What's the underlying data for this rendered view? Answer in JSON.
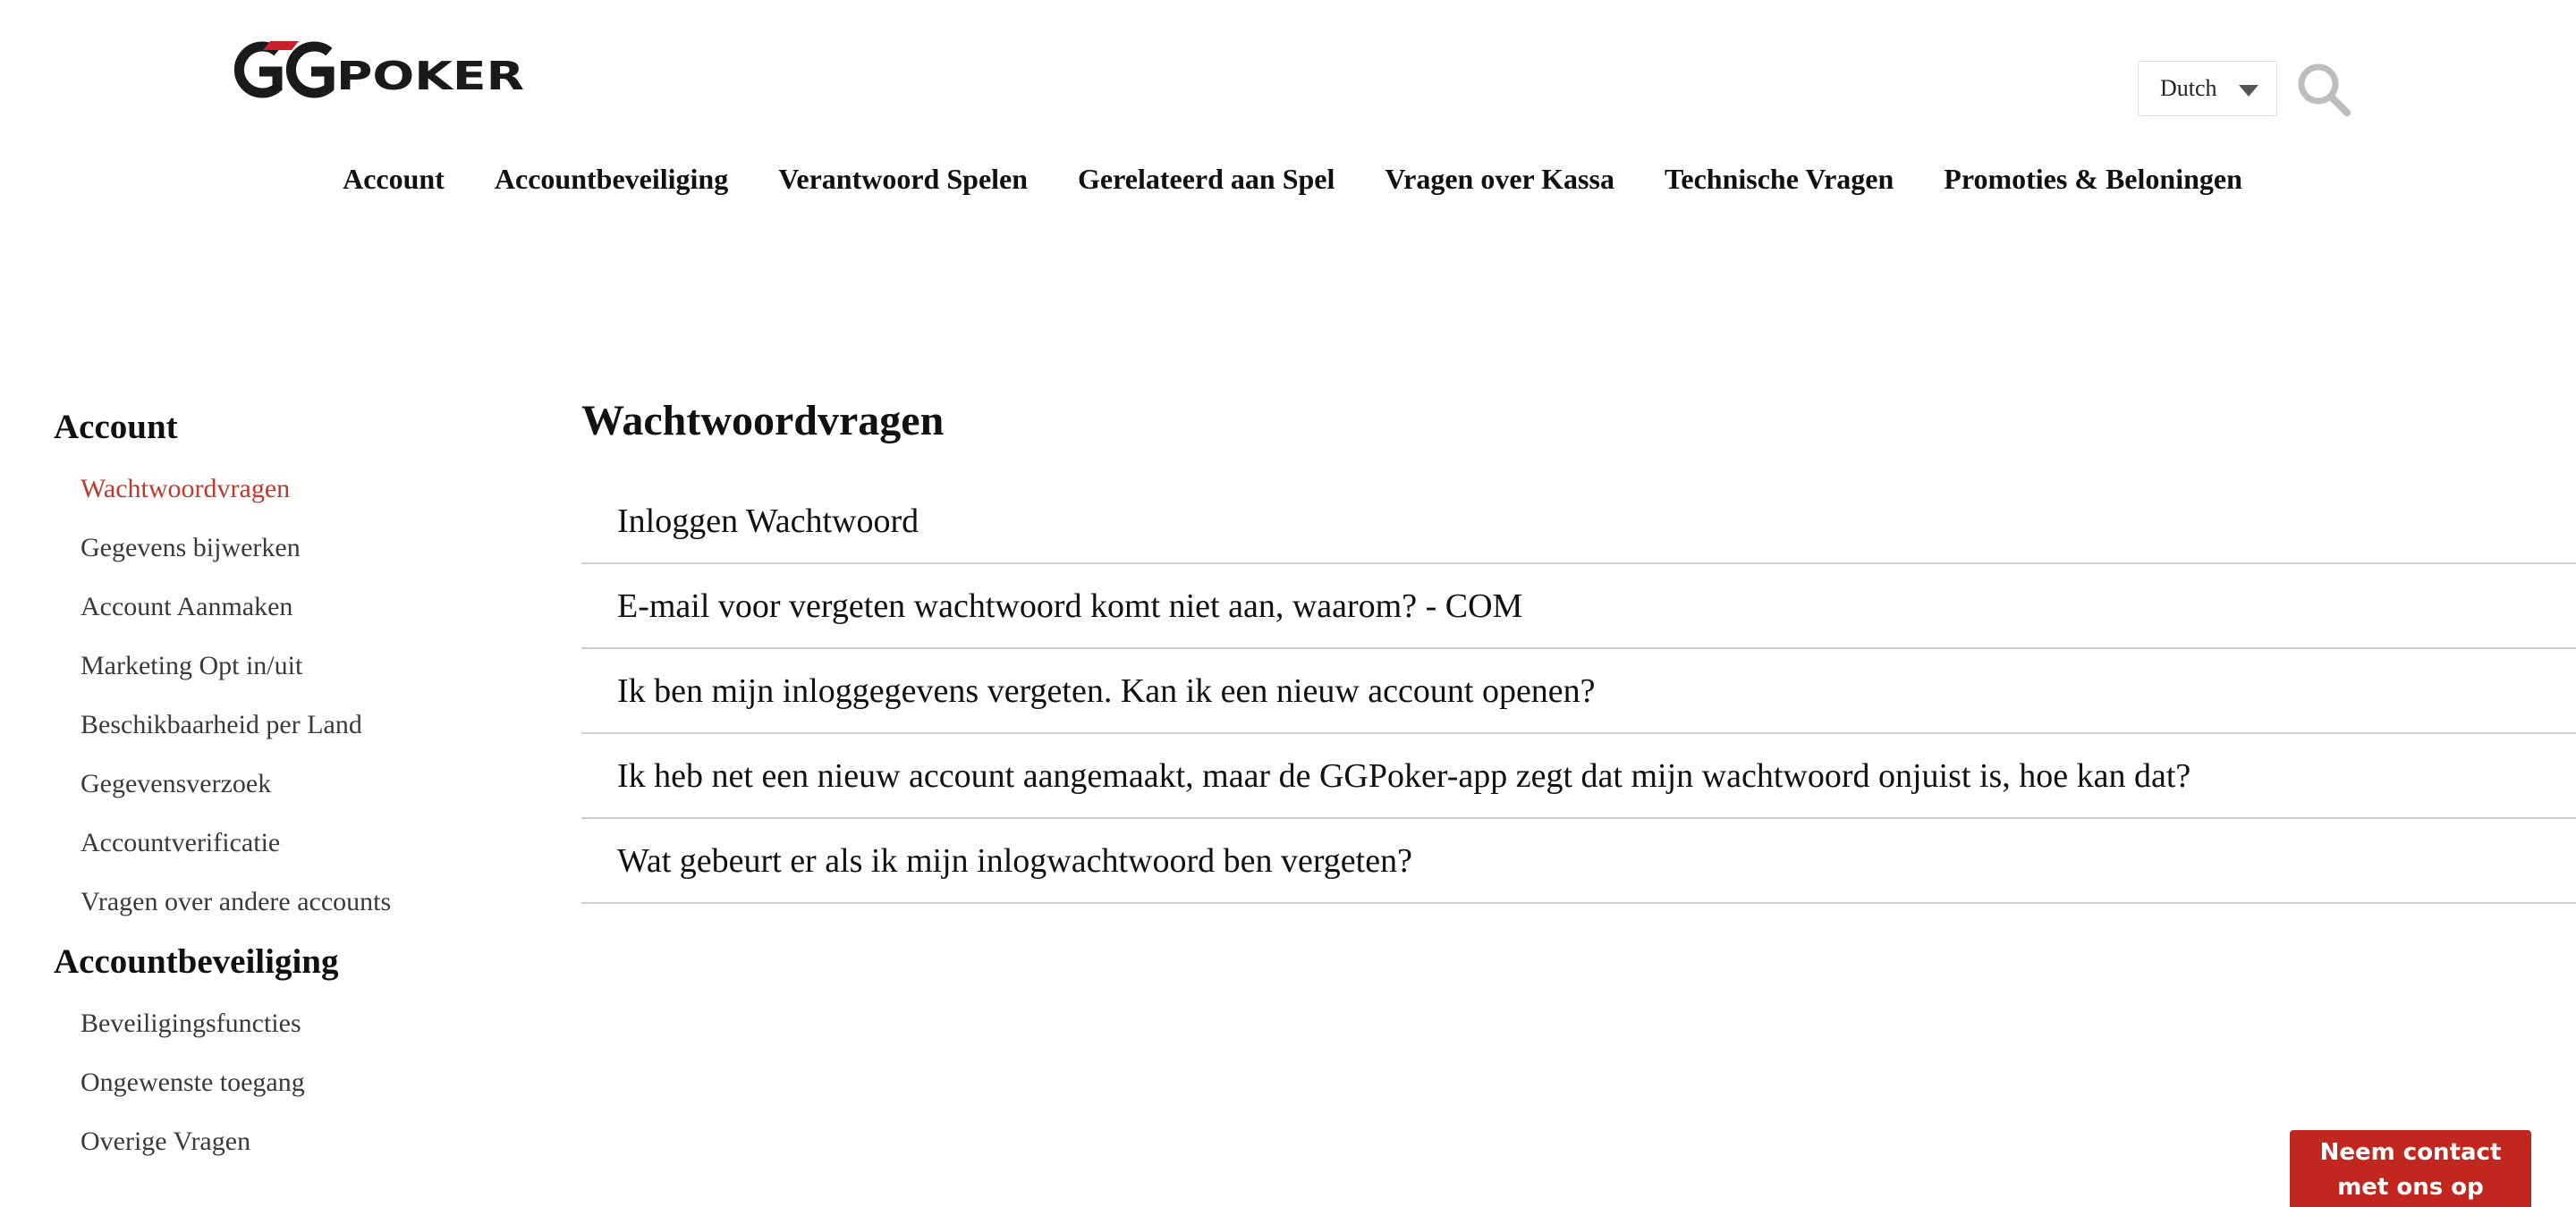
{
  "header": {
    "logo": {
      "text": "GGPOKER",
      "mark_letters": "GG",
      "word": "POKER",
      "accent_color": "#c8202f"
    },
    "language": {
      "selected": "Dutch"
    },
    "search": {
      "icon": "search-icon"
    }
  },
  "nav": {
    "items": [
      {
        "label": "Account"
      },
      {
        "label": "Accountbeveiliging"
      },
      {
        "label": "Verantwoord Spelen"
      },
      {
        "label": "Gerelateerd aan Spel"
      },
      {
        "label": "Vragen over Kassa"
      },
      {
        "label": "Technische Vragen"
      },
      {
        "label": "Promoties & Beloningen"
      }
    ]
  },
  "sidebar": {
    "sections": [
      {
        "title": "Account",
        "items": [
          {
            "label": "Wachtwoordvragen",
            "active": true
          },
          {
            "label": "Gegevens bijwerken"
          },
          {
            "label": "Account Aanmaken"
          },
          {
            "label": "Marketing Opt in/uit"
          },
          {
            "label": "Beschikbaarheid per Land"
          },
          {
            "label": "Gegevensverzoek"
          },
          {
            "label": "Accountverificatie"
          },
          {
            "label": "Vragen over andere accounts"
          }
        ]
      },
      {
        "title": "Accountbeveiliging",
        "items": [
          {
            "label": "Beveiligingsfuncties"
          },
          {
            "label": "Ongewenste toegang"
          },
          {
            "label": "Overige Vragen"
          }
        ]
      }
    ]
  },
  "main": {
    "title": "Wachtwoordvragen",
    "articles": [
      {
        "label": "Inloggen Wachtwoord"
      },
      {
        "label": "E-mail voor vergeten wachtwoord komt niet aan, waarom? - COM"
      },
      {
        "label": "Ik ben mijn inloggegevens vergeten. Kan ik een nieuw account openen?"
      },
      {
        "label": "Ik heb net een nieuw account aangemaakt, maar de GGPoker-app zegt dat mijn wachtwoord onjuist is, hoe kan dat?"
      },
      {
        "label": "Wat gebeurt er als ik mijn inlogwachtwoord ben vergeten?"
      }
    ]
  },
  "contact": {
    "line1": "Neem contact",
    "line2": "met ons op",
    "color": "#c2271f"
  },
  "colors": {
    "active_link": "#c0392b",
    "divider": "#cfcfcf"
  }
}
